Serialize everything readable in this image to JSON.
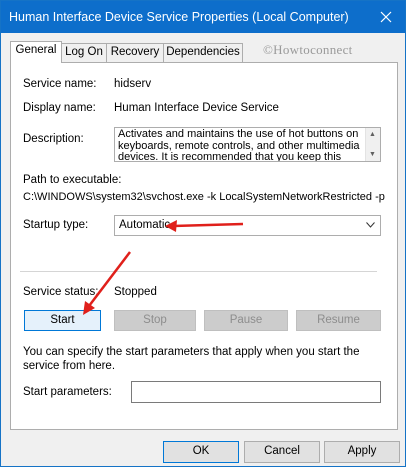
{
  "window": {
    "title": "Human Interface Device Service Properties (Local Computer)"
  },
  "tabs": [
    {
      "label": "General"
    },
    {
      "label": "Log On"
    },
    {
      "label": "Recovery"
    },
    {
      "label": "Dependencies"
    }
  ],
  "watermark": "©Howtoconnect",
  "general": {
    "service_name_label": "Service name:",
    "service_name_value": "hidserv",
    "display_name_label": "Display name:",
    "display_name_value": "Human Interface Device Service",
    "description_label": "Description:",
    "description_value": "Activates and maintains the use of hot buttons on keyboards, remote controls, and other multimedia devices. It is recommended that you keep this",
    "path_label": "Path to executable:",
    "path_value": "C:\\WINDOWS\\system32\\svchost.exe -k LocalSystemNetworkRestricted -p",
    "startup_type_label": "Startup type:",
    "startup_type_value": "Automatic",
    "service_status_label": "Service status:",
    "service_status_value": "Stopped",
    "help_text": "You can specify the start parameters that apply when you start the service from here.",
    "start_params_label": "Start parameters:",
    "start_params_value": ""
  },
  "service_buttons": {
    "start": "Start",
    "stop": "Stop",
    "pause": "Pause",
    "resume": "Resume"
  },
  "footer": {
    "ok": "OK",
    "cancel": "Cancel",
    "apply": "Apply"
  },
  "colors": {
    "titlebar": "#0d6ecb",
    "annotation_arrow": "#e0201b"
  },
  "icons": {
    "close": "close-icon",
    "dropdown": "chevron-down-icon"
  }
}
